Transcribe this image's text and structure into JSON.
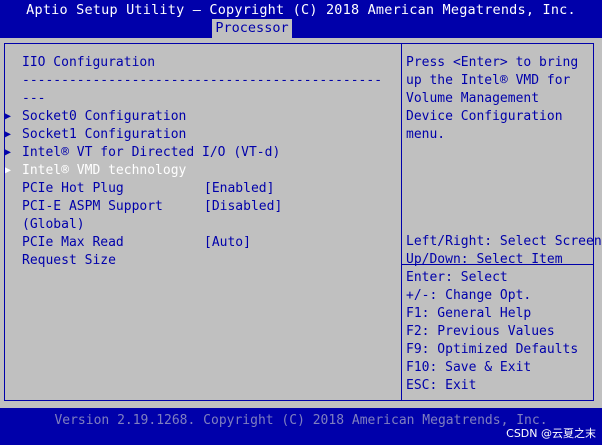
{
  "header": {
    "title": "Aptio Setup Utility – Copyright (C) 2018 American Megatrends, Inc.",
    "active_tab": "Processor"
  },
  "menu": {
    "heading": "IIO Configuration",
    "separator_line1": "----------------------------------------------",
    "separator_line2": "---",
    "items": [
      {
        "label": "Socket0 Configuration",
        "type": "submenu",
        "selected": false
      },
      {
        "label": "Socket1 Configuration",
        "type": "submenu",
        "selected": false
      },
      {
        "label": "Intel® VT for Directed I/O (VT-d)",
        "type": "submenu",
        "selected": false
      },
      {
        "label": "Intel® VMD technology",
        "type": "submenu",
        "selected": true
      }
    ],
    "settings": [
      {
        "label_lines": [
          "PCIe Hot Plug"
        ],
        "value": "[Enabled]"
      },
      {
        "label_lines": [
          "PCI-E ASPM Support",
          "(Global)"
        ],
        "value": "[Disabled]"
      },
      {
        "label_lines": [
          "PCIe Max Read",
          "Request Size"
        ],
        "value": "[Auto]"
      }
    ]
  },
  "help": {
    "lines": [
      "Press <Enter> to bring",
      "up the Intel® VMD for",
      "Volume Management",
      "Device Configuration",
      "menu."
    ]
  },
  "keys": {
    "lines": [
      "Left/Right: Select Screen",
      "Up/Down: Select Item",
      "Enter: Select",
      "+/-: Change Opt.",
      "F1: General Help",
      "F2: Previous Values",
      "F9: Optimized Defaults",
      "F10: Save & Exit",
      "ESC: Exit"
    ]
  },
  "footer": {
    "version": "Version 2.19.1268. Copyright (C) 2018 American Megatrends, Inc.",
    "watermark": "CSDN @云夏之末"
  },
  "colors": {
    "bios_blue": "#0000aa",
    "panel_gray": "#c0c0c0",
    "highlight_white": "#ffffff"
  }
}
